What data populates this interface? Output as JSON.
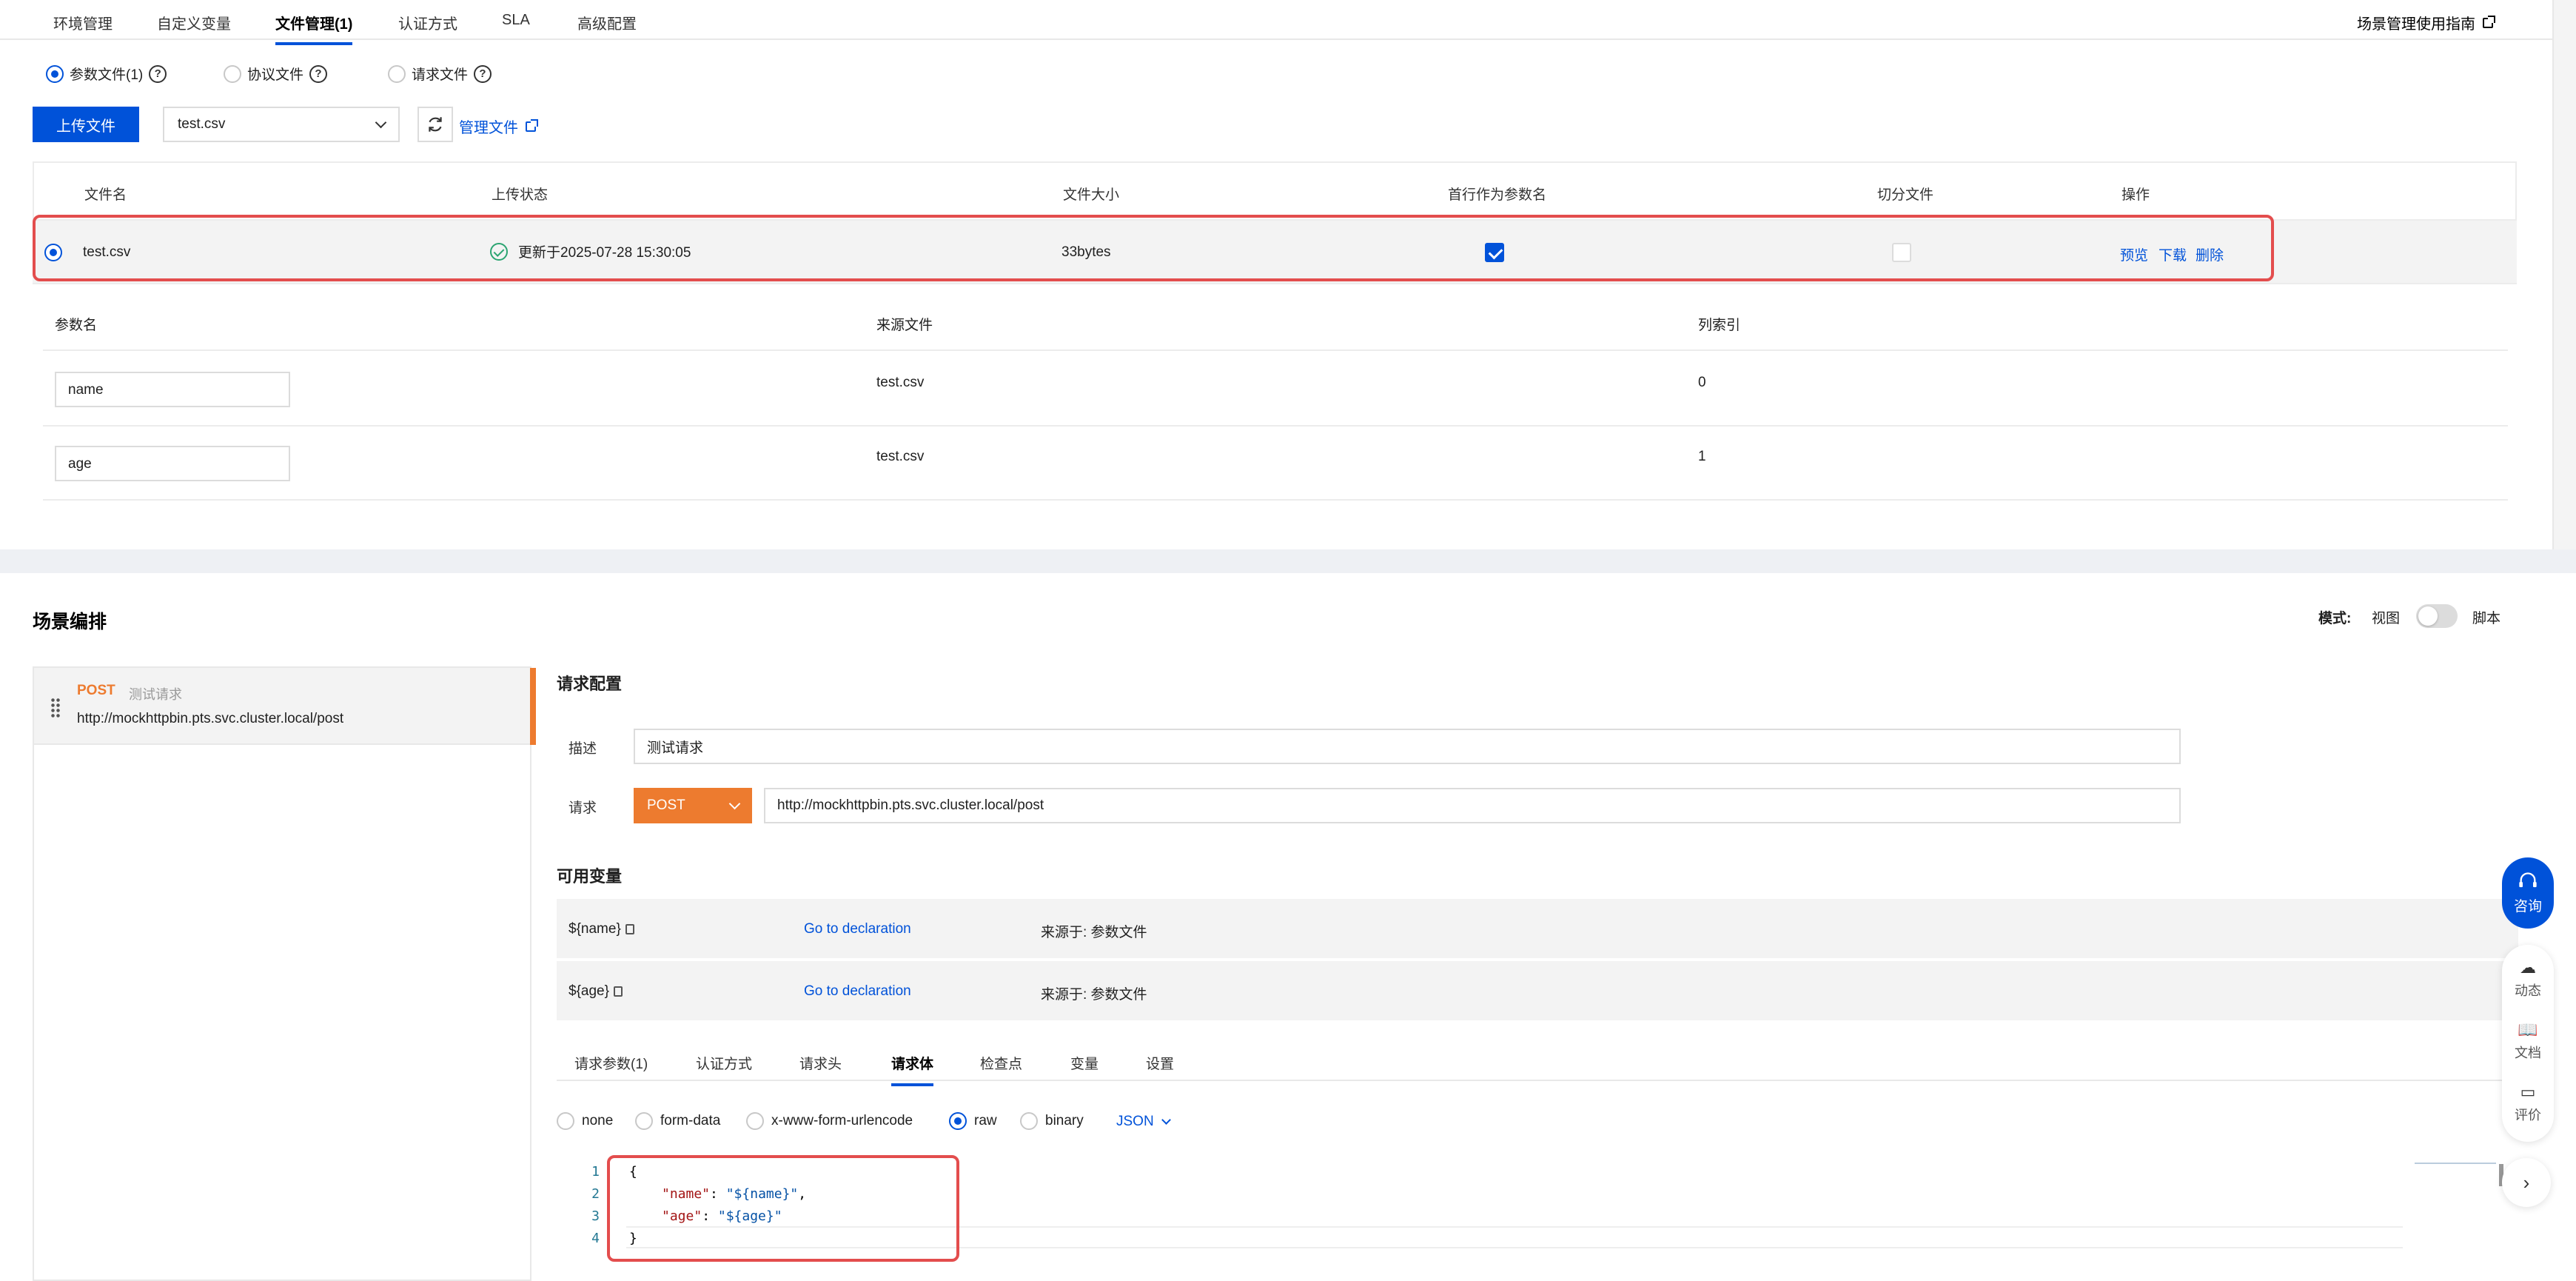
{
  "top_tabs": [
    "环境管理",
    "自定义变量",
    "文件管理(1)",
    "认证方式",
    "SLA",
    "高级配置"
  ],
  "guide_link": "场景管理使用指南",
  "file_types": [
    "参数文件(1)",
    "协议文件",
    "请求文件"
  ],
  "upload_button": "上传文件",
  "file_select": "test.csv",
  "manage_files": "管理文件",
  "file_table": {
    "headers": [
      "文件名",
      "上传状态",
      "文件大小",
      "首行作为参数名",
      "切分文件",
      "操作"
    ],
    "row": {
      "name": "test.csv",
      "status": "更新于2025-07-28 15:30:05",
      "size": "33bytes",
      "first_row_as_param": true,
      "split_file": false,
      "actions": [
        "预览",
        "下载",
        "删除"
      ]
    }
  },
  "param_table": {
    "headers": [
      "参数名",
      "来源文件",
      "列索引"
    ],
    "rows": [
      {
        "name": "name",
        "source": "test.csv",
        "index": "0"
      },
      {
        "name": "age",
        "source": "test.csv",
        "index": "1"
      }
    ]
  },
  "scenario": {
    "title": "场景编排",
    "mode_label": "模式:",
    "mode_view": "视图",
    "mode_script": "脚本",
    "request_item": {
      "method": "POST",
      "name": "测试请求",
      "url": "http://mockhttpbin.pts.svc.cluster.local/post"
    },
    "request_config_title": "请求配置",
    "desc_label": "描述",
    "desc_value": "测试请求",
    "request_label": "请求",
    "method_value": "POST",
    "url_value": "http://mockhttpbin.pts.svc.cluster.local/post",
    "vars_title": "可用变量",
    "vars": [
      {
        "name": "${name}",
        "link": "Go to declaration",
        "source": "来源于: 参数文件"
      },
      {
        "name": "${age}",
        "link": "Go to declaration",
        "source": "来源于: 参数文件"
      }
    ],
    "sub_tabs": [
      "请求参数(1)",
      "认证方式",
      "请求头",
      "请求体",
      "检查点",
      "变量",
      "设置"
    ],
    "body_types": [
      "none",
      "form-data",
      "x-www-form-urlencode",
      "raw",
      "binary"
    ],
    "format": "JSON",
    "code_lines": [
      "1",
      "2",
      "3",
      "4"
    ],
    "code": {
      "open": "{",
      "k1": "\"name\"",
      "v1": "\"${name}\"",
      "k2": "\"age\"",
      "v2": "\"${age}\"",
      "close": "}"
    }
  },
  "side_widgets": {
    "consult": "咨询",
    "items": [
      "动态",
      "文档",
      "评价"
    ]
  },
  "colors": {
    "primary": "#0052d9",
    "accent": "#ed7b2f",
    "highlight": "#e34d4d"
  }
}
